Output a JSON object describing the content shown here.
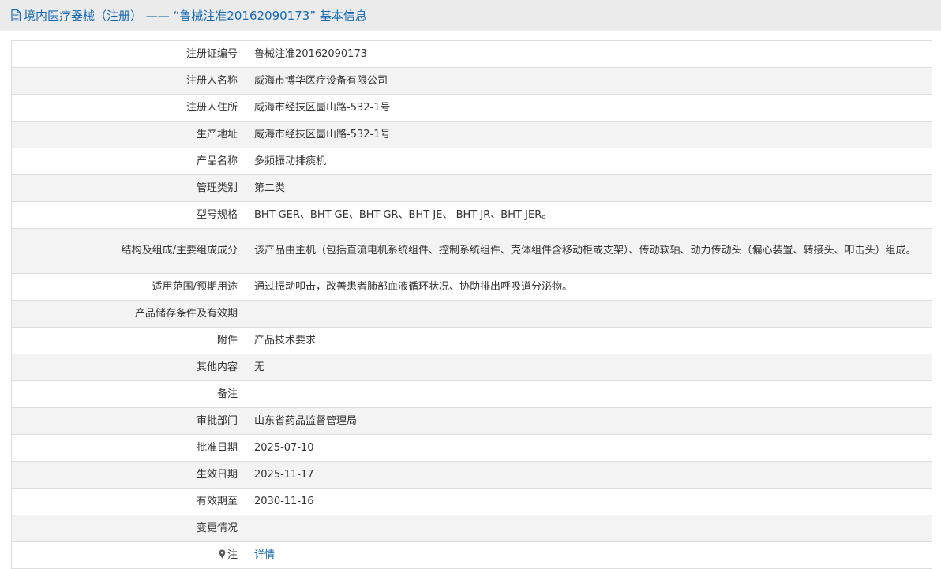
{
  "header": {
    "icon": "document-icon",
    "title": "境内医疗器械（注册） —— “鲁械注准20162090173” 基本信息"
  },
  "colors": {
    "accent": "#1668b4",
    "header_bg": "#ebebeb",
    "row_alt_bg": "#f3f3f3",
    "border": "#dddddd"
  },
  "rows": [
    {
      "label": "注册证编号",
      "value": "鲁械注准20162090173"
    },
    {
      "label": "注册人名称",
      "value": "威海市博华医疗设备有限公司"
    },
    {
      "label": "注册人住所",
      "value": "威海市经技区崮山路-532-1号"
    },
    {
      "label": "生产地址",
      "value": "威海市经技区崮山路-532-1号"
    },
    {
      "label": "产品名称",
      "value": "多频振动排痰机"
    },
    {
      "label": "管理类别",
      "value": "第二类"
    },
    {
      "label": "型号规格",
      "value": "BHT-GER、BHT-GE、BHT-GR、BHT-JE、 BHT-JR、BHT-JER。"
    },
    {
      "label": "结构及组成/主要组成成分",
      "value": "该产品由主机（包括直流电机系统组件、控制系统组件、壳体组件含移动柜或支架）、传动软轴、动力传动头（偏心装置、转接头、叩击头）组成。"
    },
    {
      "label": "适用范围/预期用途",
      "value": "通过振动叩击，改善患者肺部血液循环状况、协助排出呼吸道分泌物。"
    },
    {
      "label": "产品储存条件及有效期",
      "value": ""
    },
    {
      "label": "附件",
      "value": "产品技术要求"
    },
    {
      "label": "其他内容",
      "value": "无"
    },
    {
      "label": "备注",
      "value": ""
    },
    {
      "label": "审批部门",
      "value": "山东省药品监督管理局"
    },
    {
      "label": "批准日期",
      "value": "2025-07-10"
    },
    {
      "label": "生效日期",
      "value": "2025-11-17"
    },
    {
      "label": "有效期至",
      "value": "2030-11-16"
    },
    {
      "label": "变更情况",
      "value": ""
    },
    {
      "label": "注",
      "value": "详情",
      "icon": "location-pin-icon"
    }
  ]
}
